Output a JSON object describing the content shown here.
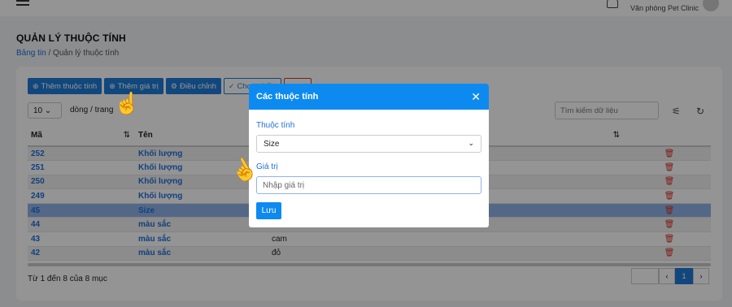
{
  "header": {
    "office": "Văn phòng Pet Clinic"
  },
  "page": {
    "title": "QUẢN LÝ THUỘC TÍNH",
    "breadcrumb": {
      "home": "Bảng tin",
      "sep": "/",
      "current": "Quản lý thuộc tính"
    }
  },
  "toolbar": {
    "add_attribute": "Thêm thuộc tính",
    "add_value": "Thêm giá trị",
    "adjust": "Điều chỉnh",
    "select_many": "Chọn nhiều"
  },
  "list": {
    "page_size": "10",
    "page_size_label": "dòng / trang",
    "search_placeholder": "Tìm kiếm dữ liệu",
    "columns": {
      "id": "Mã",
      "name": "Tên"
    },
    "rows": [
      {
        "id": "252",
        "name": "Khối lượng",
        "value": ""
      },
      {
        "id": "251",
        "name": "Khối lượng",
        "value": ""
      },
      {
        "id": "250",
        "name": "Khối lượng",
        "value": ""
      },
      {
        "id": "249",
        "name": "Khối lượng",
        "value": ""
      },
      {
        "id": "45",
        "name": "Size",
        "value": ""
      },
      {
        "id": "44",
        "name": "màu sắc",
        "value": ""
      },
      {
        "id": "43",
        "name": "màu sắc",
        "value": "cam"
      },
      {
        "id": "42",
        "name": "màu sắc",
        "value": "đỏ"
      }
    ],
    "footer": "Từ 1 đến 8 của 8 mục",
    "pager": {
      "prev": "‹",
      "current": "1",
      "next": "›"
    }
  },
  "modal": {
    "title": "Các thuộc tính",
    "attribute_label": "Thuộc tính",
    "attribute_value": "Size",
    "value_label": "Giá trị",
    "value_placeholder": "Nhập giá trị",
    "save": "Lưu"
  },
  "colors": {
    "primary": "#0d8af0",
    "danger": "#d9342b",
    "link": "#1e6fd9"
  }
}
